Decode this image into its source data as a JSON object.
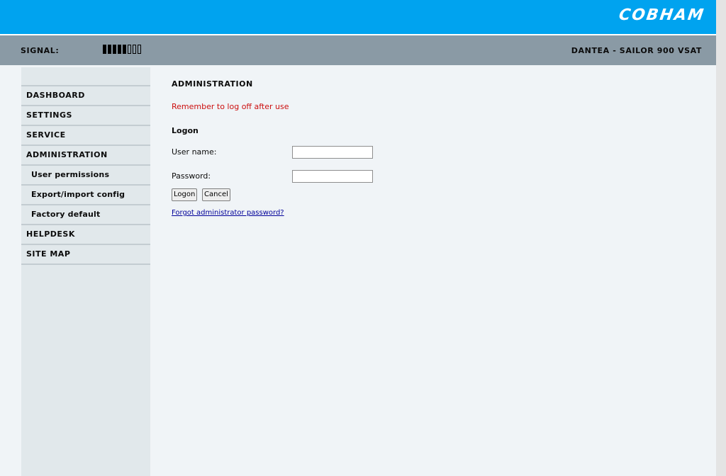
{
  "header": {
    "brand": "COBHAM",
    "brand_color": "#00a3ef",
    "signal_label": "SIGNAL:",
    "signal_level": {
      "filled": 5,
      "total": 8
    },
    "device_name": "DANTEA - SAILOR 900 VSAT",
    "statusbar_color": "#8a9aa5"
  },
  "sidebar": {
    "items": [
      {
        "label": "DASHBOARD"
      },
      {
        "label": "SETTINGS"
      },
      {
        "label": "SERVICE"
      },
      {
        "label": "ADMINISTRATION"
      },
      {
        "label": "User permissions"
      },
      {
        "label": "Export/import config"
      },
      {
        "label": "Factory default"
      },
      {
        "label": "HELPDESK"
      },
      {
        "label": "SITE MAP"
      }
    ]
  },
  "main": {
    "title": "ADMINISTRATION",
    "warning": "Remember to log off after use",
    "warning_color": "#cc0f0f",
    "section_title": "Logon",
    "username_label": "User name:",
    "username_value": "",
    "password_label": "Password:",
    "password_value": "",
    "logon_button": "Logon",
    "cancel_button": "Cancel",
    "forgot_link": "Forgot administrator password?"
  }
}
